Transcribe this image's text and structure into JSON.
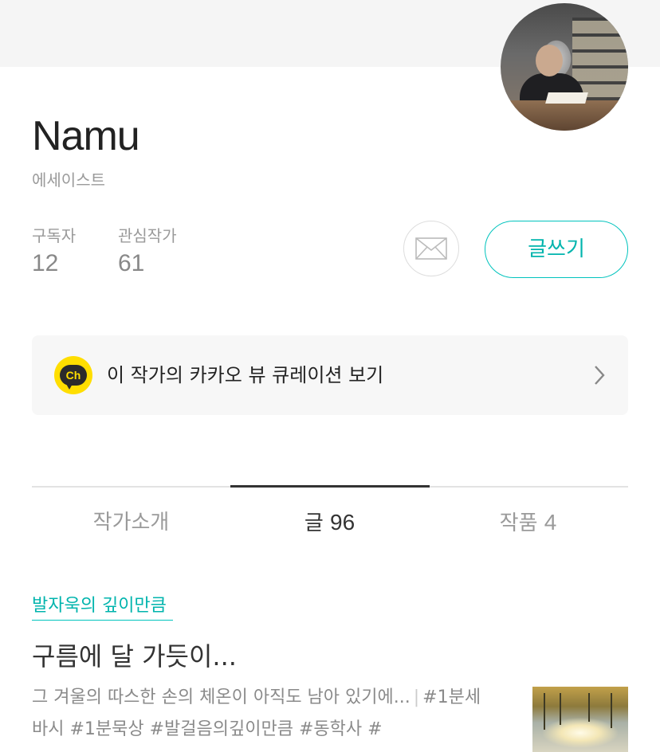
{
  "profile": {
    "name": "Namu",
    "role": "에세이스트",
    "stats": [
      {
        "label": "구독자",
        "value": "12"
      },
      {
        "label": "관심작가",
        "value": "61"
      }
    ],
    "write_button": "글쓰기"
  },
  "kakao": {
    "badge": "Ch",
    "text": "이 작가의 카카오 뷰 큐레이션 보기"
  },
  "tabs": [
    {
      "label": "작가소개",
      "count": ""
    },
    {
      "label": "글",
      "count": "96"
    },
    {
      "label": "작품",
      "count": "4"
    }
  ],
  "post": {
    "magazine": "발자욱의 깊이만큼",
    "title": "구름에 달 가듯이...",
    "excerpt": "그 겨울의 따스한 손의 체온이 아직도 남아 있기에...",
    "separator": "|",
    "tags": "#1분세바시 #1분묵상 #발걸음의깊이만큼  #동학사 #"
  },
  "colors": {
    "accent": "#00b4ad",
    "kakao_yellow": "#ffde00"
  }
}
